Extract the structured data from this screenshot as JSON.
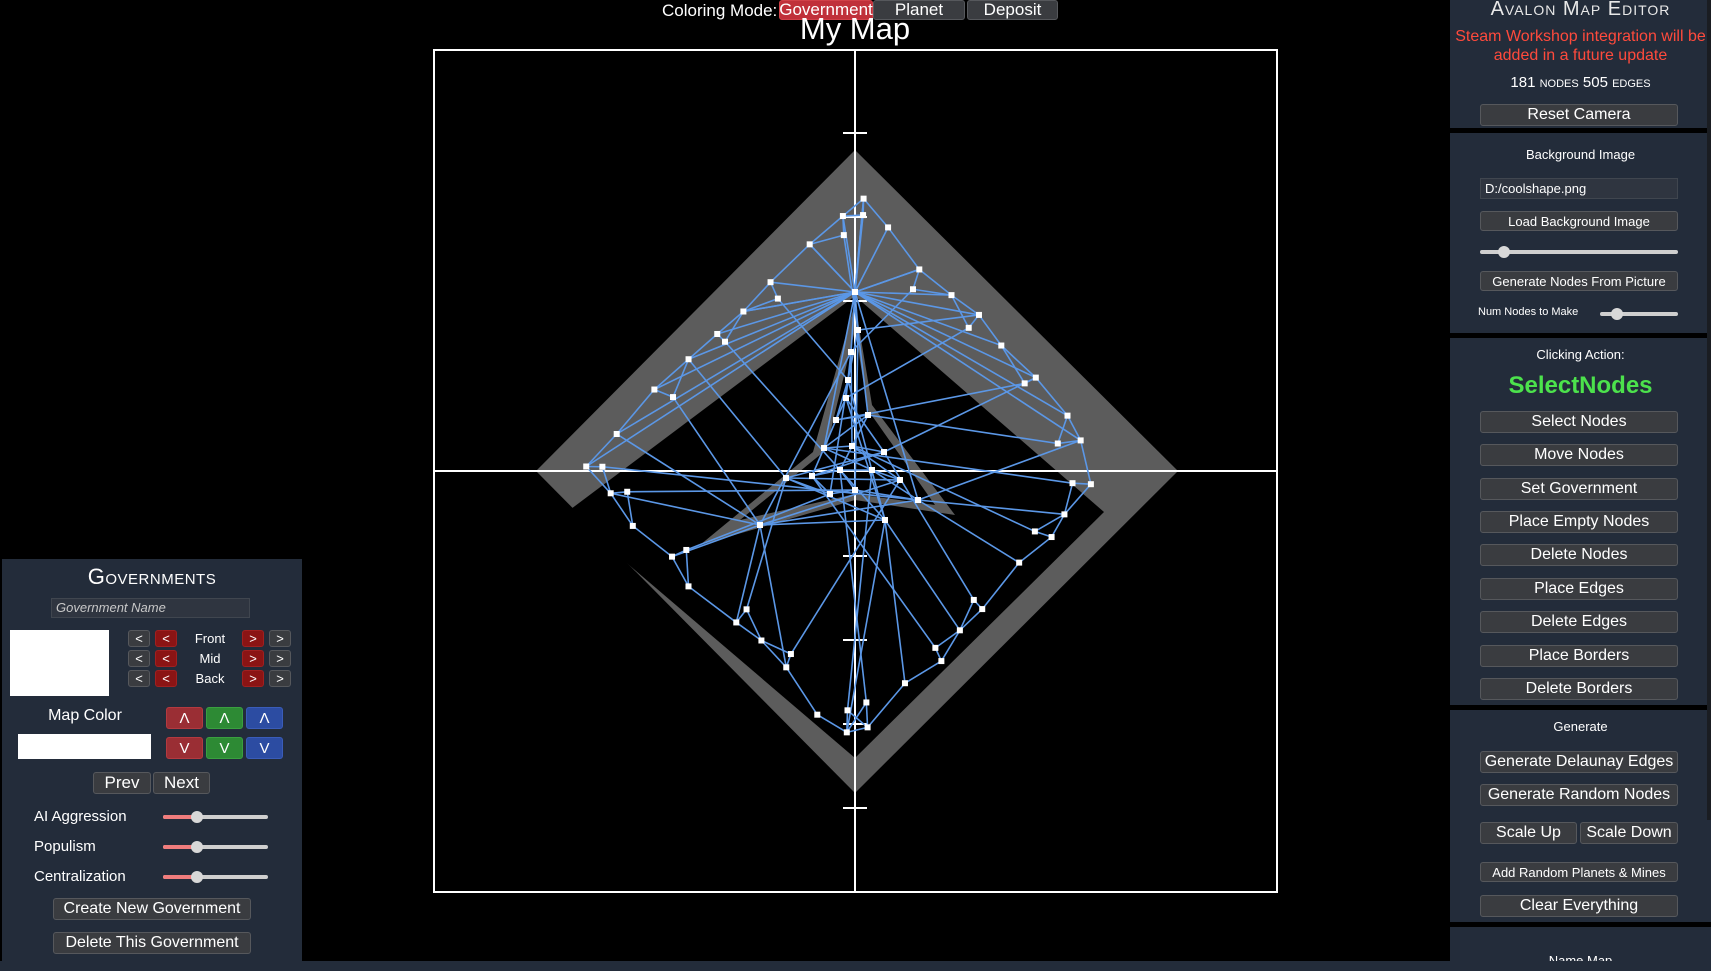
{
  "top_bar": {
    "coloring_label": "Coloring Mode:",
    "modes": [
      {
        "label": "Government",
        "active": true
      },
      {
        "label": "Planet",
        "active": false
      },
      {
        "label": "Deposit",
        "active": false
      }
    ],
    "map_title": "My Map"
  },
  "editor": {
    "title": "Avalon Map Editor",
    "steam_message_line1": "Steam Workshop integration will be",
    "steam_message_line2": "added in a future update",
    "nodes_count": "181",
    "nodes_label": "nodes",
    "edges_count": "505",
    "edges_label": "edges",
    "reset_camera": "Reset Camera",
    "background": {
      "heading": "Background Image",
      "path": "D:/coolshape.png",
      "load_button": "Load Background Image",
      "opacity_value": 0.12,
      "generate_button": "Generate Nodes From Picture",
      "num_nodes_label": "Num Nodes to Make",
      "num_nodes_value": 0.22
    },
    "clicking": {
      "heading": "Clicking Action:",
      "current": "SelectNodes",
      "current_color": "#4ce24c",
      "actions": [
        "Select Nodes",
        "Move Nodes",
        "Set Government",
        "Place Empty Nodes",
        "Delete Nodes",
        "Place Edges",
        "Delete Edges",
        "Place Borders",
        "Delete Borders"
      ]
    },
    "generate": {
      "heading": "Generate",
      "delaunay": "Generate Delaunay Edges",
      "random_nodes": "Generate Random Nodes",
      "scale_up": "Scale Up",
      "scale_down": "Scale Down",
      "random_planets": "Add Random Planets & Mines",
      "clear": "Clear Everything"
    },
    "name_map_partial": "Name Map"
  },
  "governments": {
    "heading": "Governments",
    "name_placeholder": "Government Name",
    "swatch_color": "#ffffff",
    "layers": [
      "Front",
      "Mid",
      "Back"
    ],
    "arrow_left": "<",
    "arrow_right": ">",
    "map_color_label": "Map Color",
    "map_color": "#ffffff",
    "up_symbol": "Λ",
    "down_symbol": "V",
    "prev": "Prev",
    "next": "Next",
    "sliders": [
      {
        "label": "AI Aggression",
        "value": 0.32
      },
      {
        "label": "Populism",
        "value": 0.32
      },
      {
        "label": "Centralization",
        "value": 0.32
      }
    ],
    "create_button": "Create New Government",
    "delete_button": "Delete This Government"
  },
  "colors": {
    "edge_blue": "#5b97e6",
    "panel_bg": "#232c3a",
    "steam_red": "#ff4a3c",
    "active_mode_red": "#c0303a"
  }
}
